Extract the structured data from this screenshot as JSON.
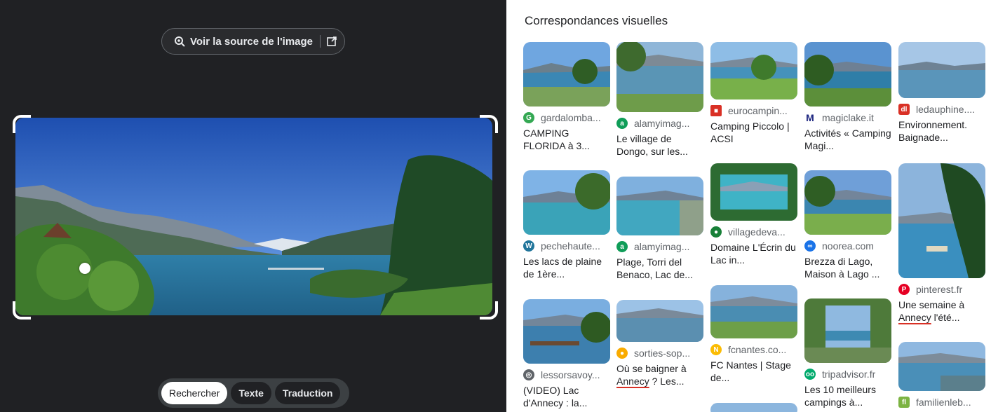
{
  "viewer": {
    "source_button_label": "Voir la source de l'image",
    "modes": [
      "Rechercher",
      "Texte",
      "Traduction"
    ],
    "active_mode": "Rechercher"
  },
  "results": {
    "heading": "Correspondances visuelles",
    "cards": [
      {
        "source": "gardalomba...",
        "title": "CAMPING FLORIDA à 3...",
        "favicon": "gardalombarda-icon",
        "color": "#34a853"
      },
      {
        "source": "alamyimag...",
        "title": "Le village de Dongo, sur les...",
        "favicon": "alamy-icon",
        "color": "#0f9d58"
      },
      {
        "source": "eurocampin...",
        "title": "Camping Piccolo | ACSI",
        "favicon": "eurocampings-icon",
        "color": "#d93025"
      },
      {
        "source": "magiclake.it",
        "title": "Activités « Camping Magi...",
        "favicon": "magiclake-icon",
        "color": "#1a237e"
      },
      {
        "source": "ledauphine....",
        "title": "Environnement. Baignade...",
        "favicon": "ledauphine-icon",
        "color": "#d93025"
      },
      {
        "source": "pechehaute...",
        "title": "Les lacs de plaine de 1ère...",
        "favicon": "wordpress-icon",
        "color": "#21759b"
      },
      {
        "source": "alamyimag...",
        "title": "Plage, Torri del Benaco, Lac de...",
        "favicon": "alamy-icon",
        "color": "#0f9d58"
      },
      {
        "source": "villagedeva...",
        "title": "Domaine L'Écrin du Lac in...",
        "favicon": "villagedevacances-icon",
        "color": "#188038"
      },
      {
        "source": "noorea.com",
        "title": "Brezza di Lago, Maison à Lago ...",
        "favicon": "noorea-icon",
        "color": "#1a73e8"
      },
      {
        "source": "pinterest.fr",
        "title": "Une semaine à Annecy l'été...",
        "favicon": "pinterest-icon",
        "color": "#e60023"
      },
      {
        "source": "lessorsavoy...",
        "title": "(VIDEO) Lac d'Annecy : la...",
        "favicon": "globe-icon",
        "color": "#5f6368"
      },
      {
        "source": "sorties-sop...",
        "title": "Où se baigner à Annecy ? Les...",
        "favicon": "sorties-icon",
        "color": "#f9ab00"
      },
      {
        "source": "fcnantes.co...",
        "title": "FC Nantes | Stage de...",
        "favicon": "fcnantes-icon",
        "color": "#fbbc04"
      },
      {
        "source": "tripadvisor.fr",
        "title": "Les 10 meilleurs campings à...",
        "favicon": "tripadvisor-icon",
        "color": "#00aa6c"
      },
      {
        "source": "familienleb...",
        "title": "",
        "favicon": "familienleben-icon",
        "color": "#7cb342"
      }
    ]
  }
}
